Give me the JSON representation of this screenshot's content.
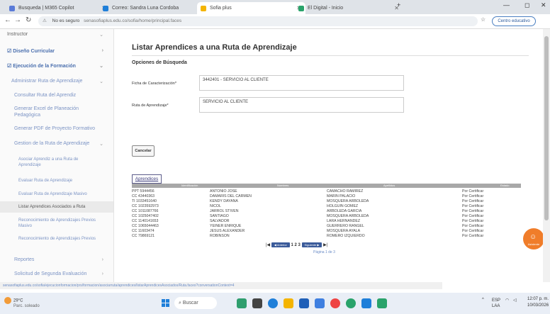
{
  "browser": {
    "tabs": [
      {
        "label": "Busqueda | M365 Copilot",
        "color": "#5a7bd8"
      },
      {
        "label": "Correo: Sandra Luna Cordoba",
        "color": "#1f7fd9"
      },
      {
        "label": "Sofia plus",
        "color": "#f4b400"
      },
      {
        "label": "El Digital - Inicio",
        "color": "#2aa36b"
      }
    ],
    "new_tab": "+",
    "url_insecure": "No es seguro",
    "url": "senasofiaplus.edu.co/sofia/home/principal.faces",
    "profile": "Centro educativo"
  },
  "sidebar": {
    "top_label": "Instructor",
    "items": [
      {
        "label": "Diseño Curricular",
        "icon": "doc-icon"
      },
      {
        "label": "Ejecución de la Formación",
        "icon": "doc-icon"
      },
      {
        "label": "Administrar Ruta de Aprendizaje"
      },
      {
        "label": "Consultar Ruta del Aprendiz"
      },
      {
        "label": "Generar Excel de Planeación Pedagógica"
      },
      {
        "label": "Generar PDF de Proyecto Formativo"
      },
      {
        "label": "Gestion de la Ruta de Aprendizaje"
      },
      {
        "label": "Asociar Aprendiz a una Ruta de Aprendizaje"
      },
      {
        "label": "Evaluar Ruta de Aprendizaje"
      },
      {
        "label": "Evaluar Ruta de Aprendizaje Masivo"
      },
      {
        "label": "Listar Aprendices Asociados a Ruta"
      },
      {
        "label": "Reconocimiento de Aprendizajes Previos Masivo"
      },
      {
        "label": "Reconocimiento de Aprendizajes Previos"
      },
      {
        "label": "Reportes"
      },
      {
        "label": "Solicitud de Segunda Evaluación"
      }
    ]
  },
  "main": {
    "title": "Listar Aprendices a una Ruta de Aprendizaje",
    "search_section": "Opciones de Búsqueda",
    "ficha_label": "Ficha de Caracterización*",
    "ficha_value": "3442401 - SERVICIO AL CLIENTE",
    "ruta_label": "Ruta de Aprendizaje*",
    "ruta_value": "SERVICIO AL CLIENTE",
    "cancel_button": "Cancelar",
    "apprentices_tab": "Aprendices"
  },
  "table": {
    "headers": [
      "Identificación",
      "Nombres",
      "Apellidos",
      "Estado"
    ],
    "rows": [
      [
        "PPT 5944456",
        "ANTONIO JOSE",
        "CAMACHO RAMIREZ",
        "Por Certificar"
      ],
      [
        "CC 43440363",
        "DAMARIS DEL CARMEN",
        "MARIN PALACIO",
        "Por Certificar"
      ],
      [
        "TI 1033451640",
        "KENDY DAYANA",
        "MOSQUERA ARBOLEDA",
        "Por Certificar"
      ],
      [
        "CC 1023592973",
        "NICOL",
        "HOLGUIN GOMEZ",
        "Por Certificar"
      ],
      [
        "CC 1011087766",
        "JARROL STIVEN",
        "ARBOLEDA GARCIA",
        "Por Certificar"
      ],
      [
        "CC 1025047402",
        "SANTIAGO",
        "MOSQUERA ARBOLEDA",
        "Por Certificar"
      ],
      [
        "CC 1140141653",
        "SALVADOR",
        "LARA HERNANDEZ",
        "Por Certificar"
      ],
      [
        "CC 1065044463",
        "YEINER ENRIQUE",
        "GUERRERO RANGEL",
        "Por Certificar"
      ],
      [
        "CC 11603474",
        "JESUS ALEXANDER",
        "MOSQUERA AYALA",
        "Por Certificar"
      ],
      [
        "CC 79869121",
        "ROBINSON",
        "ROMERO IZQUIERDO",
        "Por Certificar"
      ]
    ],
    "pager": {
      "first": "|◀",
      "prev": "◀ Anterior",
      "pages": "1 2 3",
      "next": "Siguiente ▶",
      "last": "▶|",
      "page_info": "Página 1 de 3"
    }
  },
  "chatbot_label": "Asistente",
  "status_url": "senasofiaplus.edu.co/sofia/ejecucionformacion/prs/formacion/asociarruta/aprendices/listarAprendicesAsociados/Ruta.faces?conversationContext=4",
  "taskbar": {
    "temp": "29°C",
    "weather": "Parc. soleado",
    "search": "Buscar",
    "lang": "ESP",
    "lang2": "LAA",
    "time": "12:07 p. m.",
    "date": "10/03/2026"
  }
}
